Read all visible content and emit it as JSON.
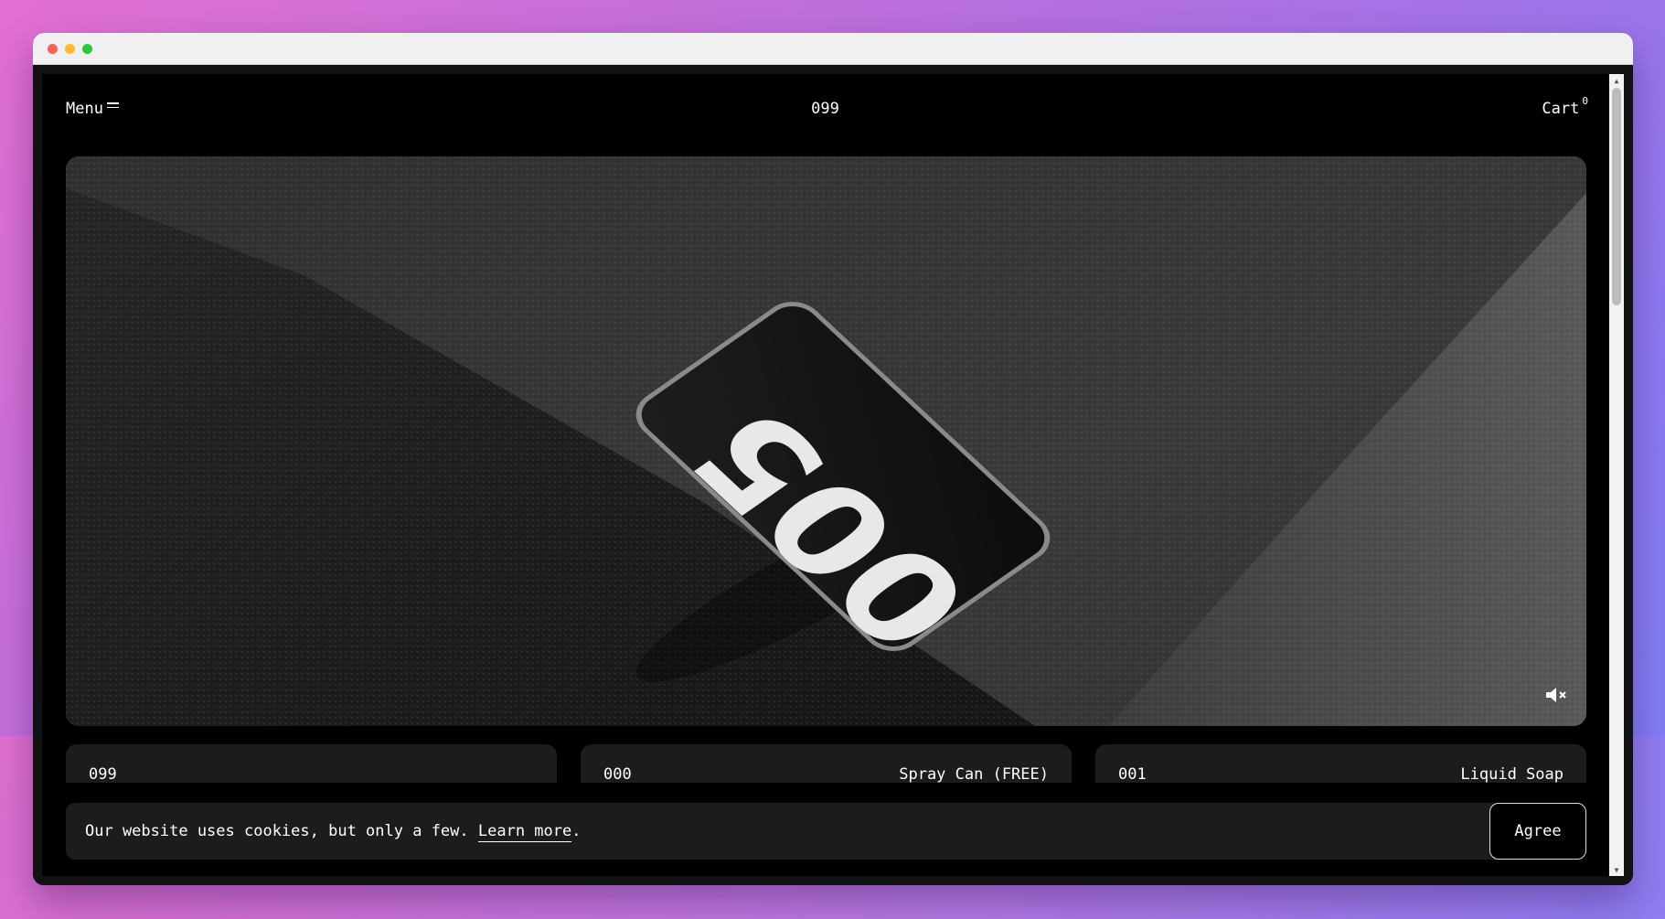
{
  "nav": {
    "menu_label": "Menu",
    "logo": "099",
    "cart_label": "Cart",
    "cart_count": "0"
  },
  "hero": {
    "phone_screen_number": "005",
    "mute_icon": "speaker-muted-icon"
  },
  "cards": [
    {
      "number": "099",
      "name": ""
    },
    {
      "number": "000",
      "name": "Spray Can (FREE)"
    },
    {
      "number": "001",
      "name": "Liquid Soap"
    }
  ],
  "cookie": {
    "text": "Our website uses cookies, but only a few. ",
    "link": "Learn more",
    "suffix": ".",
    "button": "Agree"
  },
  "colors": {
    "page_bg": "#000000",
    "card_bg": "#1c1c1c",
    "text": "#ffffff"
  }
}
